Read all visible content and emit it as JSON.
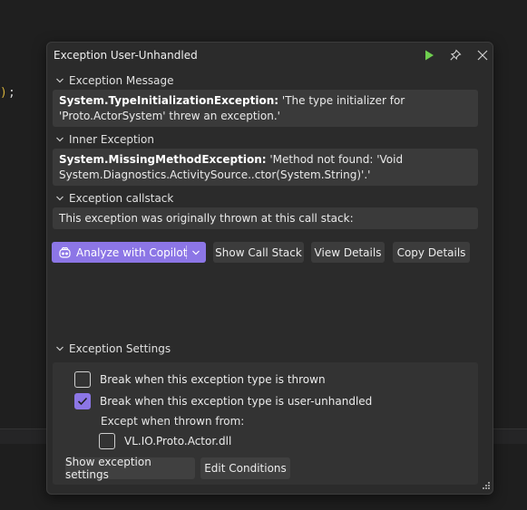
{
  "editor": {
    "paren": ")",
    "semicolon": ";"
  },
  "popup": {
    "title": "Exception User-Unhandled",
    "icons": {
      "continue": "play-icon",
      "pin": "pin-icon",
      "close": "close-icon"
    },
    "exception_message": {
      "header": "Exception Message",
      "type": "System.TypeInitializationException:",
      "text": " 'The type initializer for 'Proto.ActorSystem' threw an exception.'"
    },
    "inner_exception": {
      "header": "Inner Exception",
      "type": "System.MissingMethodException:",
      "text": " 'Method not found: 'Void System.Diagnostics.ActivitySource..ctor(System.String)'.'"
    },
    "callstack": {
      "header": "Exception callstack",
      "text": "This exception was originally thrown at this call stack:"
    },
    "actions": {
      "copilot_label": "Analyze with Copilot",
      "show_call_stack": "Show Call Stack",
      "view_details": "View Details",
      "copy_details": "Copy Details"
    },
    "settings": {
      "header": "Exception Settings",
      "break_thrown": {
        "label": "Break when this exception type is thrown",
        "checked": false
      },
      "break_user_unhandled": {
        "label": "Break when this exception type is user-unhandled",
        "checked": true
      },
      "except_label": "Except when thrown from:",
      "module": {
        "label": "VL.IO.Proto.Actor.dll",
        "checked": false
      },
      "show_settings_button": "Show exception settings",
      "edit_conditions_button": "Edit Conditions"
    }
  },
  "colors": {
    "accent": "#8c76e6",
    "play": "#6fcf4f",
    "code_paren": "#d4b03a"
  }
}
